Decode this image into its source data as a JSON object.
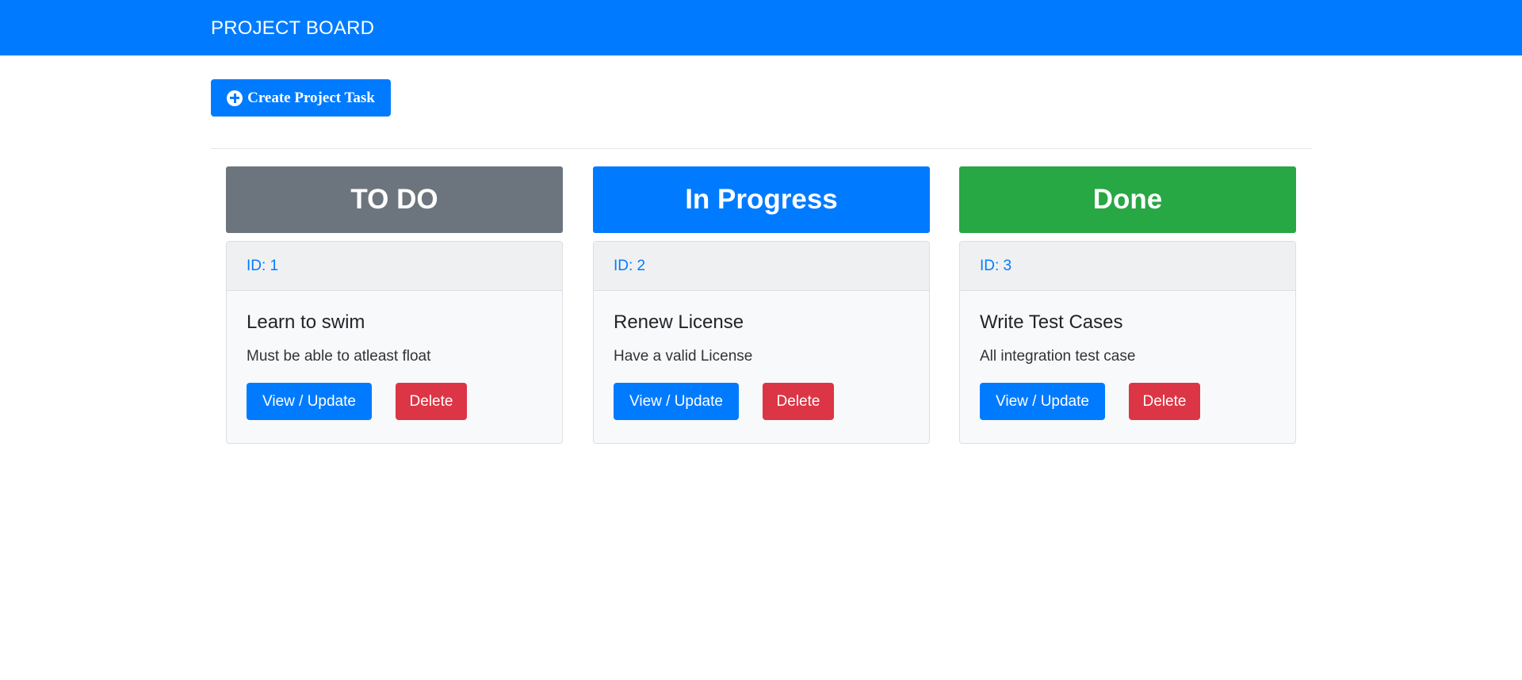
{
  "navbar": {
    "brand": "PROJECT BOARD"
  },
  "toolbar": {
    "create_label": "Create Project Task",
    "create_icon": "plus-circle-icon"
  },
  "colors": {
    "primary": "#007bff",
    "secondary": "#6c757d",
    "success": "#28a745",
    "danger": "#dc3545"
  },
  "columns": [
    {
      "title": "TO DO",
      "color": "#6c757d",
      "tasks": [
        {
          "id_label": "ID: 1",
          "title": "Learn to swim",
          "description": "Must be able to atleast float",
          "update_label": "View / Update",
          "delete_label": "Delete"
        }
      ]
    },
    {
      "title": "In Progress",
      "color": "#007bff",
      "tasks": [
        {
          "id_label": "ID: 2",
          "title": "Renew License",
          "description": "Have a valid License",
          "update_label": "View / Update",
          "delete_label": "Delete"
        }
      ]
    },
    {
      "title": "Done",
      "color": "#28a745",
      "tasks": [
        {
          "id_label": "ID: 3",
          "title": "Write Test Cases",
          "description": "All integration test case",
          "update_label": "View / Update",
          "delete_label": "Delete"
        }
      ]
    }
  ]
}
